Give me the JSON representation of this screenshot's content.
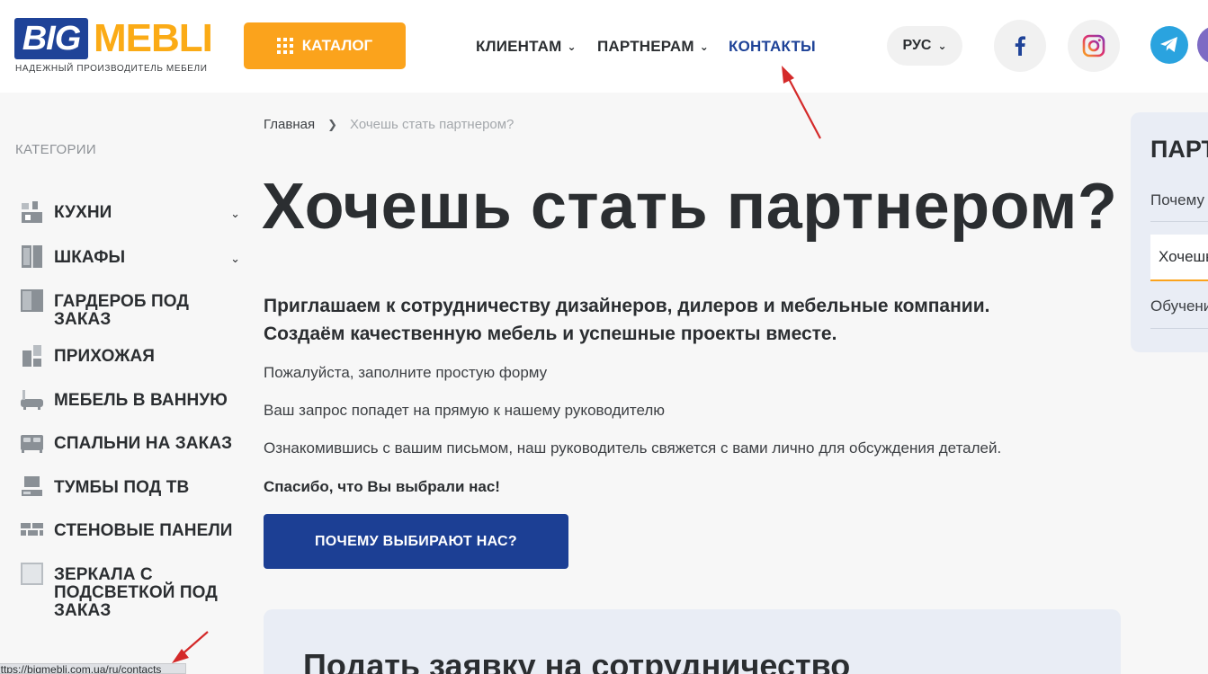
{
  "header": {
    "logo_big": "BIG",
    "logo_mebli": "MEBLI",
    "logo_tagline": "НАДЕЖНЫЙ ПРОИЗВОДИТЕЛЬ МЕБЕЛИ",
    "catalog_label": "КАТАЛОГ",
    "nav": [
      {
        "label": "КЛИЕНТАМ"
      },
      {
        "label": "ПАРТНЕРАМ"
      },
      {
        "label": "КОНТАКТЫ"
      }
    ],
    "language": "РУС",
    "social_icons": [
      "facebook-icon",
      "instagram-icon",
      "telegram-icon"
    ]
  },
  "sidebar": {
    "title": "КАТЕГОРИИ",
    "items": [
      {
        "label": "КУХНИ",
        "icon": "kitchen-icon"
      },
      {
        "label": "ШКАФЫ",
        "icon": "wardrobe-icon"
      },
      {
        "label": "ГАРДЕРОБ ПОД ЗАКАЗ",
        "icon": "dressing-room-icon"
      },
      {
        "label": "ПРИХОЖАЯ",
        "icon": "hallway-icon"
      },
      {
        "label": "МЕБЕЛЬ В ВАННУЮ",
        "icon": "bathtub-icon"
      },
      {
        "label": "СПАЛЬНИ НА ЗАКАЗ",
        "icon": "bed-icon"
      },
      {
        "label": "ТУМБЫ ПОД ТВ",
        "icon": "tv-stand-icon"
      },
      {
        "label": "СТЕНОВЫЕ ПАНЕЛИ",
        "icon": "wall-panels-icon"
      },
      {
        "label": "ЗЕРКАЛА С ПОДСВЕТКОЙ ПОД ЗАКАЗ",
        "icon": "mirror-icon"
      }
    ]
  },
  "breadcrumb": {
    "home": "Главная",
    "current": "Хочешь стать партнером?"
  },
  "main": {
    "title": "Хочешь стать партнером?",
    "lead_line1": "Приглашаем к сотрудничеству дизайнеров, дилеров и мебельные компании.",
    "lead_line2": "Создаём качественную мебель и успешные проекты вместе.",
    "para1": "Пожалуйста, заполните простую форму",
    "para2": "Ваш запрос попадет на прямую к нашему руководителю",
    "para3": "Ознакомившись с вашим письмом, наш руководитель свяжется с вами лично для обсуждения деталей.",
    "para4": "Спасибо, что Вы выбрали нас!",
    "why_button": "ПОЧЕМУ ВЫБИРАЮТ НАС?",
    "form_title": "Подать заявку на сотрудничество"
  },
  "right_panel": {
    "title": "ПАРТНЕРАМ",
    "link1": "Почему выбирают нас?",
    "active": "Хочешь стать партнером?",
    "link3": "Обучение"
  },
  "statusbar": {
    "url": "https://bigmebli.com.ua/ru/contacts"
  },
  "colors": {
    "brand_blue": "#1f4398",
    "brand_orange": "#fba31c",
    "annotation_red": "#d42a2a"
  }
}
